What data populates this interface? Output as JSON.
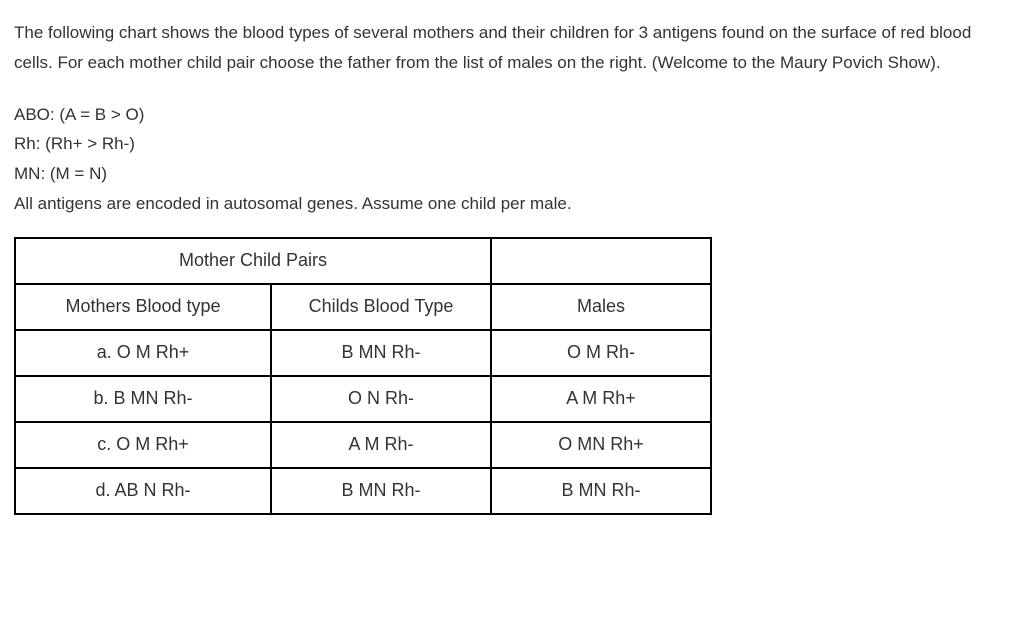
{
  "intro": "The following chart shows the blood types of several mothers and their children for 3 antigens found on the surface of red blood cells.  For each mother child pair choose the father from the list of males on the right. (Welcome to the Maury Povich Show).",
  "rules": {
    "abo": "ABO: (A = B > O)",
    "rh": "Rh:   (Rh+ > Rh-)",
    "mn": "MN:  (M = N)",
    "note": "All antigens are encoded in autosomal genes.  Assume one child per male."
  },
  "table": {
    "header_span": "Mother Child Pairs",
    "col_mother": "Mothers Blood type",
    "col_child": "Childs Blood Type",
    "col_male": "Males",
    "rows": [
      {
        "mother": "a. O  M   Rh+",
        "child": "B MN Rh-",
        "male": "O  M  Rh-"
      },
      {
        "mother": "b. B  MN Rh-",
        "child": "O   N  Rh-",
        "male": "A  M   Rh+"
      },
      {
        "mother": "c. O   M  Rh+",
        "child": "A  M   Rh-",
        "male": "O  MN Rh+"
      },
      {
        "mother": "d. AB N  Rh-",
        "child": "B MN  Rh-",
        "male": "B  MN Rh-"
      }
    ]
  }
}
